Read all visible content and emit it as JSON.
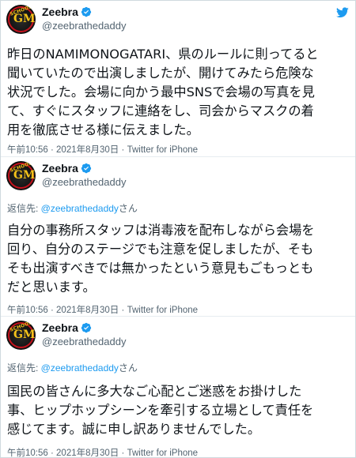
{
  "tweets": [
    {
      "name": "Zeebra",
      "handle": "@zeebrathedaddy",
      "text_lines": [
        "昨日のNAMIMONOGATARI、県のルールに則ってると",
        "聞いていたので出演しましたが、開けてみたら危険な",
        "状況でした。会場に向かう最中SNSで会場の写真を見",
        "て、すぐにスタッフに連絡をし、司会からマスクの着",
        "用を徹底させる様に伝えました。"
      ],
      "time": "午前10:56",
      "date": "2021年8月30日",
      "source": "Twitter for iPhone",
      "sep": "·"
    },
    {
      "name": "Zeebra",
      "handle": "@zeebrathedaddy",
      "reply_prefix": "返信先: ",
      "reply_mention": "@zeebrathedaddy",
      "reply_suffix": "さん",
      "text_lines": [
        "自分の事務所スタッフは消毒液を配布しながら会場を",
        "回り、自分のステージでも注意を促しましたが、そも",
        "そも出演すべきでは無かったという意見もごもっとも",
        "だと思います。"
      ],
      "time": "午前10:56",
      "date": "2021年8月30日",
      "source": "Twitter for iPhone",
      "sep": "·"
    },
    {
      "name": "Zeebra",
      "handle": "@zeebrathedaddy",
      "reply_prefix": "返信先: ",
      "reply_mention": "@zeebrathedaddy",
      "reply_suffix": "さん",
      "text_lines": [
        "国民の皆さんに多大なご心配とご迷惑をお掛けした",
        "事、ヒップホップシーンを牽引する立場として責任を",
        "感じてます。誠に申し訳ありませんでした。"
      ],
      "time": "午前10:56",
      "date": "2021年8月30日",
      "source": "Twitter for iPhone",
      "sep": "·"
    }
  ],
  "avatar": {
    "letters": "GM",
    "arc_text": "SCHOOL"
  },
  "colors": {
    "accent": "#1d9bf0",
    "muted": "#536471",
    "text": "#0f1419",
    "avatar_ring": "#c5121d",
    "avatar_letter": "#f3c21a"
  },
  "icons": {
    "verified": "verified-badge-icon",
    "logo": "twitter-bird-icon"
  }
}
